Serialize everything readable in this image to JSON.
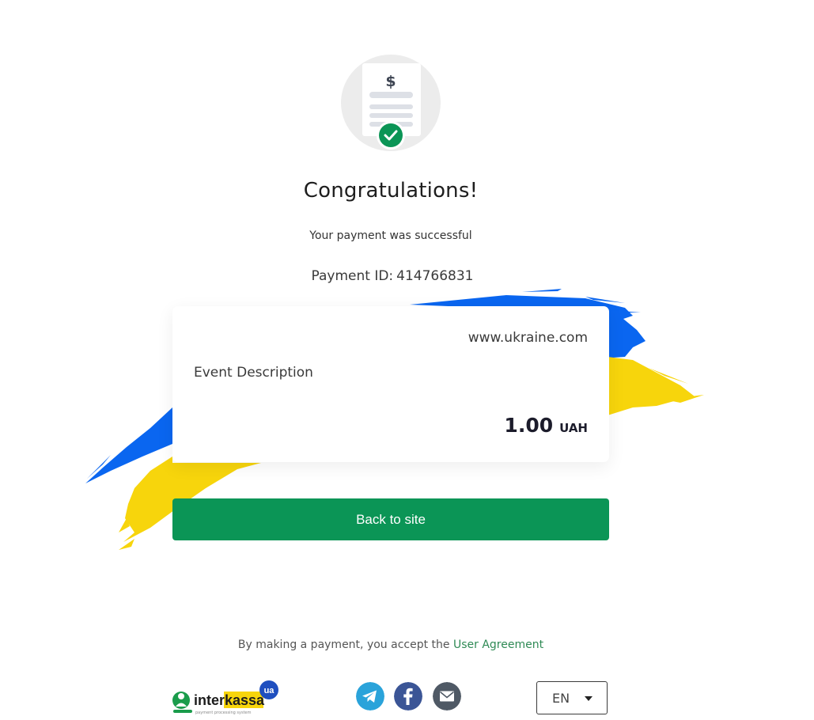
{
  "hero": {
    "icon": "receipt-check-icon",
    "currency_symbol": "$"
  },
  "title": "Congratulations!",
  "subtitle": "Your payment was successful",
  "payment": {
    "id_label": "Payment ID:",
    "id_value": "414766831"
  },
  "card": {
    "site": "www.ukraine.com",
    "description": "Event Description",
    "amount": "1.00",
    "currency": "UAH"
  },
  "back_button": {
    "label": "Back to site"
  },
  "footer": {
    "agreement_text": "By making a payment, you accept the",
    "agreement_link": "User Agreement",
    "logo": {
      "name": "interkassa",
      "badge": "ua",
      "tagline": "payment processing system"
    },
    "social": [
      "telegram-icon",
      "facebook-icon",
      "email-icon"
    ],
    "language": "EN"
  },
  "colors": {
    "accent_green": "#0b9556",
    "link_green": "#2f8a55",
    "flag_blue": "#0a66f0",
    "flag_yellow": "#f7d50c"
  }
}
